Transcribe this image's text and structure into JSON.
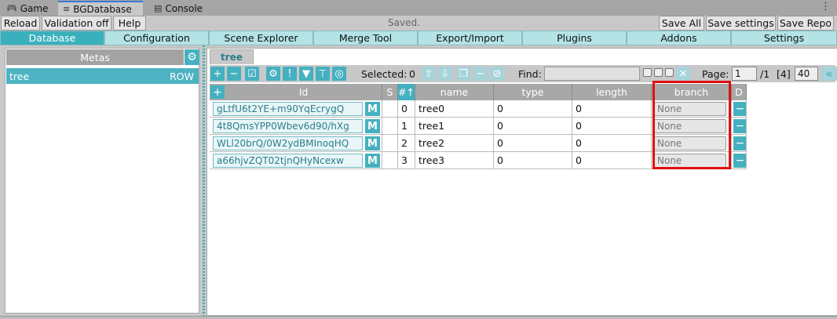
{
  "editor_tabs": [
    {
      "label": "Game",
      "icon": "gamepad-icon"
    },
    {
      "label": "BGDatabase",
      "icon": "list-icon"
    },
    {
      "label": "Console",
      "icon": "console-icon"
    }
  ],
  "toolbar": {
    "reload": "Reload",
    "validation": "Validation off",
    "help": "Help",
    "status": "Saved.",
    "save_all": "Save All",
    "save_settings": "Save settings",
    "save_repo": "Save Repo"
  },
  "main_tabs": [
    "Database",
    "Configuration",
    "Scene Explorer",
    "Merge Tool",
    "Export/Import",
    "Plugins",
    "Addons",
    "Settings"
  ],
  "left": {
    "header": "Metas",
    "items": [
      {
        "name": "tree",
        "kind": "ROW"
      }
    ]
  },
  "right": {
    "tab": "tree",
    "toolbar": {
      "selected_label": "Selected:",
      "selected_count": "0",
      "find_label": "Find:",
      "page_label": "Page:",
      "page_value": "1",
      "page_total": "/1",
      "count": "[4]",
      "page_size": "40"
    },
    "columns": [
      "Id",
      "S",
      "#↑",
      "name",
      "type",
      "length",
      "branch",
      "D"
    ],
    "rows": [
      {
        "id": "gLtfU6t2YE+m90YqEcrygQ",
        "m": "M",
        "num": "0",
        "name": "tree0",
        "type": "0",
        "length": "0",
        "branch": "None"
      },
      {
        "id": "4t8QmsYPP0Wbev6d90/hXg",
        "m": "M",
        "num": "1",
        "name": "tree1",
        "type": "0",
        "length": "0",
        "branch": "None"
      },
      {
        "id": "WLl20brQ/0W2ydBMInoqHQ",
        "m": "M",
        "num": "2",
        "name": "tree2",
        "type": "0",
        "length": "0",
        "branch": "None"
      },
      {
        "id": "a66hjvZQT02tjnQHyNcexw",
        "m": "M",
        "num": "3",
        "name": "tree3",
        "type": "0",
        "length": "0",
        "branch": "None"
      }
    ]
  },
  "colors": {
    "accent": "#45b0c0",
    "active_tab": "#3ab0bc",
    "highlight": "#e01010",
    "tab_bg": "#b4e3e6"
  }
}
